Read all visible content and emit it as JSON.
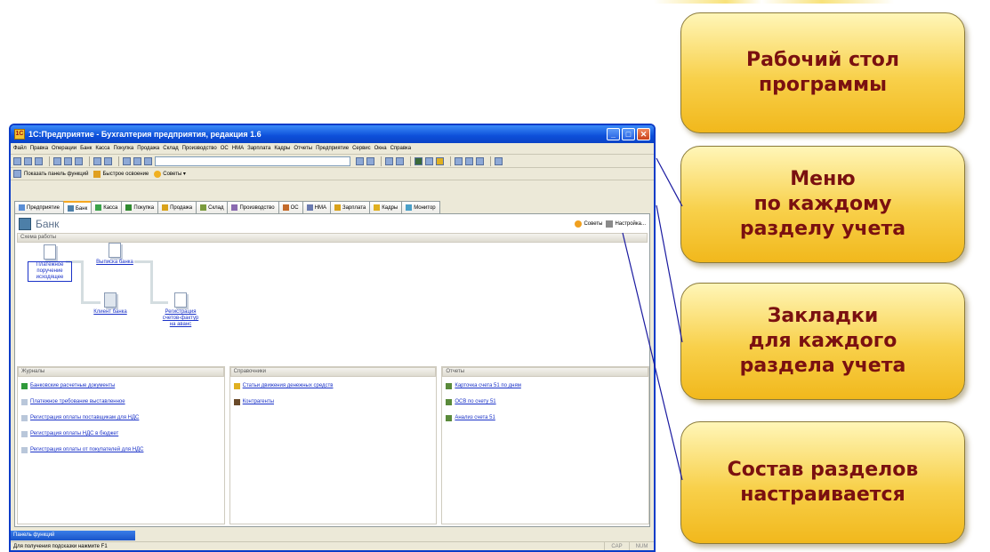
{
  "window": {
    "title": "1С:Предприятие - Бухгалтерия предприятия, редакция 1.6",
    "app_icon": "1C"
  },
  "menu": [
    "Файл",
    "Правка",
    "Операции",
    "Банк",
    "Касса",
    "Покупка",
    "Продажа",
    "Склад",
    "Производство",
    "ОС",
    "НМА",
    "Зарплата",
    "Кадры",
    "Отчеты",
    "Предприятие",
    "Сервис",
    "Окна",
    "Справка"
  ],
  "toolbar": {
    "show_panel": "Показать панель функций",
    "quick_start": "Быстрое освоение",
    "tips": "Советы"
  },
  "tabs": [
    {
      "label": "Предприятие",
      "color": "#5a8ed6"
    },
    {
      "label": "Банк",
      "color": "#4d7fa8"
    },
    {
      "label": "Касса",
      "color": "#3aa34a"
    },
    {
      "label": "Покупка",
      "color": "#2f8a2f"
    },
    {
      "label": "Продажа",
      "color": "#d9a21a"
    },
    {
      "label": "Склад",
      "color": "#7b9b3d"
    },
    {
      "label": "Производство",
      "color": "#8a6ab0"
    },
    {
      "label": "ОС",
      "color": "#c46a2a"
    },
    {
      "label": "НМА",
      "color": "#6a7ab0"
    },
    {
      "label": "Зарплата",
      "color": "#d9a21a"
    },
    {
      "label": "Кадры",
      "color": "#e0b020"
    },
    {
      "label": "Монитор",
      "color": "#4aa0c8"
    }
  ],
  "page": {
    "title": "Банк",
    "tips_btn": "Советы",
    "settings_btn": "Настройка...",
    "scheme_header": "Схема работы"
  },
  "scheme": {
    "payment_order": "Платежное поручение исходящее",
    "bank_statement": "Выписка банка",
    "bank_client": "Клиент банка",
    "invoice_reg": "Регистрация счетов-фактур на аванс"
  },
  "panels": {
    "journals": {
      "header": "Журналы",
      "items": [
        "Банковские расчетные документы",
        "Платежное требование выставленное",
        "Регистрация оплаты поставщикам для НДС",
        "Регистрация оплаты НДС в бюджет",
        "Регистрация оплаты от покупателей для НДС"
      ]
    },
    "directories": {
      "header": "Справочники",
      "items": [
        "Статьи движения денежных средств",
        "Контрагенты"
      ]
    },
    "reports": {
      "header": "Отчеты",
      "items": [
        "Карточка счета 51 по дням",
        "ОСВ по счету 51",
        "Анализ счета 51"
      ]
    }
  },
  "funcbar": "Панель функций",
  "status": {
    "hint": "Для получения подсказки нажмите F1",
    "cap": "CAP",
    "num": "NUM"
  },
  "callouts": [
    "Рабочий стол\nпрограммы",
    "Меню\nпо каждому\nразделу учета",
    "Закладки\nдля каждого\nраздела учета",
    "Состав разделов\nнастраивается"
  ],
  "colors": {
    "titlebar": "#0d4fd9",
    "callout_text": "#7a1010",
    "callout_fill": "#f8d04a",
    "link": "#1a32c8",
    "connector": "#1a1aa0"
  }
}
